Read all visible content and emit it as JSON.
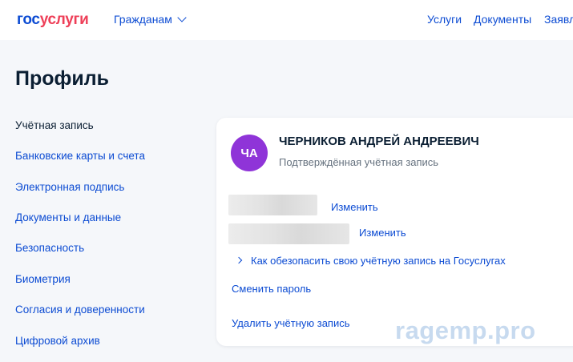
{
  "header": {
    "logo": {
      "part1": "гос",
      "part2": "услуги"
    },
    "citizens": "Гражданам",
    "nav": [
      "Услуги",
      "Документы",
      "Заявл"
    ]
  },
  "page": {
    "title": "Профиль"
  },
  "sidebar": {
    "items": [
      {
        "label": "Учётная запись",
        "active": true
      },
      {
        "label": "Банковские карты и счета"
      },
      {
        "label": "Электронная подпись"
      },
      {
        "label": "Документы и данные"
      },
      {
        "label": "Безопасность"
      },
      {
        "label": "Биометрия"
      },
      {
        "label": "Согласия и доверенности"
      },
      {
        "label": "Цифровой архив"
      }
    ]
  },
  "account": {
    "initials": "ЧА",
    "full_name": "ЧЕРНИКОВ АНДРЕЙ АНДРЕЕВИЧ",
    "status": "Подтверждённая учётная запись",
    "change_label_1": "Изменить",
    "change_label_2": "Изменить",
    "secure_link": "Как обезопасить свою учётную запись на Госуслугах",
    "change_password": "Сменить пароль",
    "delete_account": "Удалить учётную запись"
  },
  "watermark": "ragemp.pro",
  "colors": {
    "brand_blue": "#0d4cd3",
    "brand_red": "#ee3f58",
    "avatar": "#8f34d8",
    "text": "#0b1f33",
    "muted": "#66727f"
  }
}
